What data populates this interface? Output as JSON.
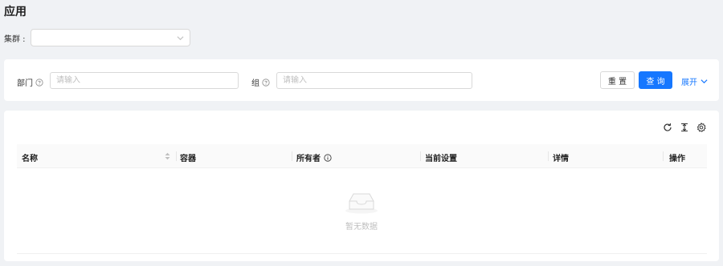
{
  "page": {
    "title": "应用"
  },
  "cluster": {
    "label": "集群 :",
    "value": ""
  },
  "filters": {
    "department_label": "部门",
    "department_placeholder": "请输入",
    "group_label": "组",
    "group_placeholder": "请输入",
    "reset_label": "重 置",
    "query_label": "查 询",
    "expand_label": "展开"
  },
  "table": {
    "columns": [
      "名称",
      "容器",
      "所有者",
      "当前设置",
      "详情",
      "操作"
    ],
    "empty_text": "暂无数据"
  },
  "colors": {
    "primary": "#1677ff",
    "background": "#f0f2f5"
  },
  "icons": [
    "chevron-down-icon",
    "help-circle-icon",
    "refresh-icon",
    "column-height-icon",
    "settings-icon",
    "info-circle-icon",
    "sort-icon",
    "empty-inbox-icon"
  ]
}
